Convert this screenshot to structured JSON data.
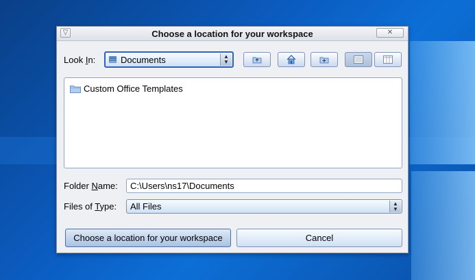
{
  "dialog": {
    "title": "Choose a location for your workspace",
    "menu_glyph": "▽",
    "close_glyph": "✕"
  },
  "lookin": {
    "label_prefix": "Look ",
    "label_mnemonic": "I",
    "label_suffix": "n:",
    "value": "Documents",
    "icon": "documents-icon"
  },
  "toolbar": {
    "buttons": [
      {
        "name": "up-one-level",
        "icon": "folder-up-icon"
      },
      {
        "name": "home",
        "icon": "home-icon"
      },
      {
        "name": "new-folder",
        "icon": "new-folder-icon"
      },
      {
        "name": "list-view",
        "icon": "list-view-icon",
        "selected": true
      },
      {
        "name": "details-view",
        "icon": "details-view-icon"
      }
    ]
  },
  "files": [
    {
      "name": "Custom Office Templates",
      "icon": "folder-icon"
    }
  ],
  "folder_name": {
    "label_prefix": "Folder ",
    "label_mnemonic": "N",
    "label_suffix": "ame:",
    "value": "C:\\Users\\ns17\\Documents"
  },
  "files_of_type": {
    "label_prefix": "Files of ",
    "label_mnemonic": "T",
    "label_suffix": "ype:",
    "value": "All Files"
  },
  "buttons": {
    "choose": "Choose a location for your workspace",
    "cancel": "Cancel"
  },
  "colors": {
    "accent": "#2f62b8",
    "desktop": "#0b5cc0"
  }
}
